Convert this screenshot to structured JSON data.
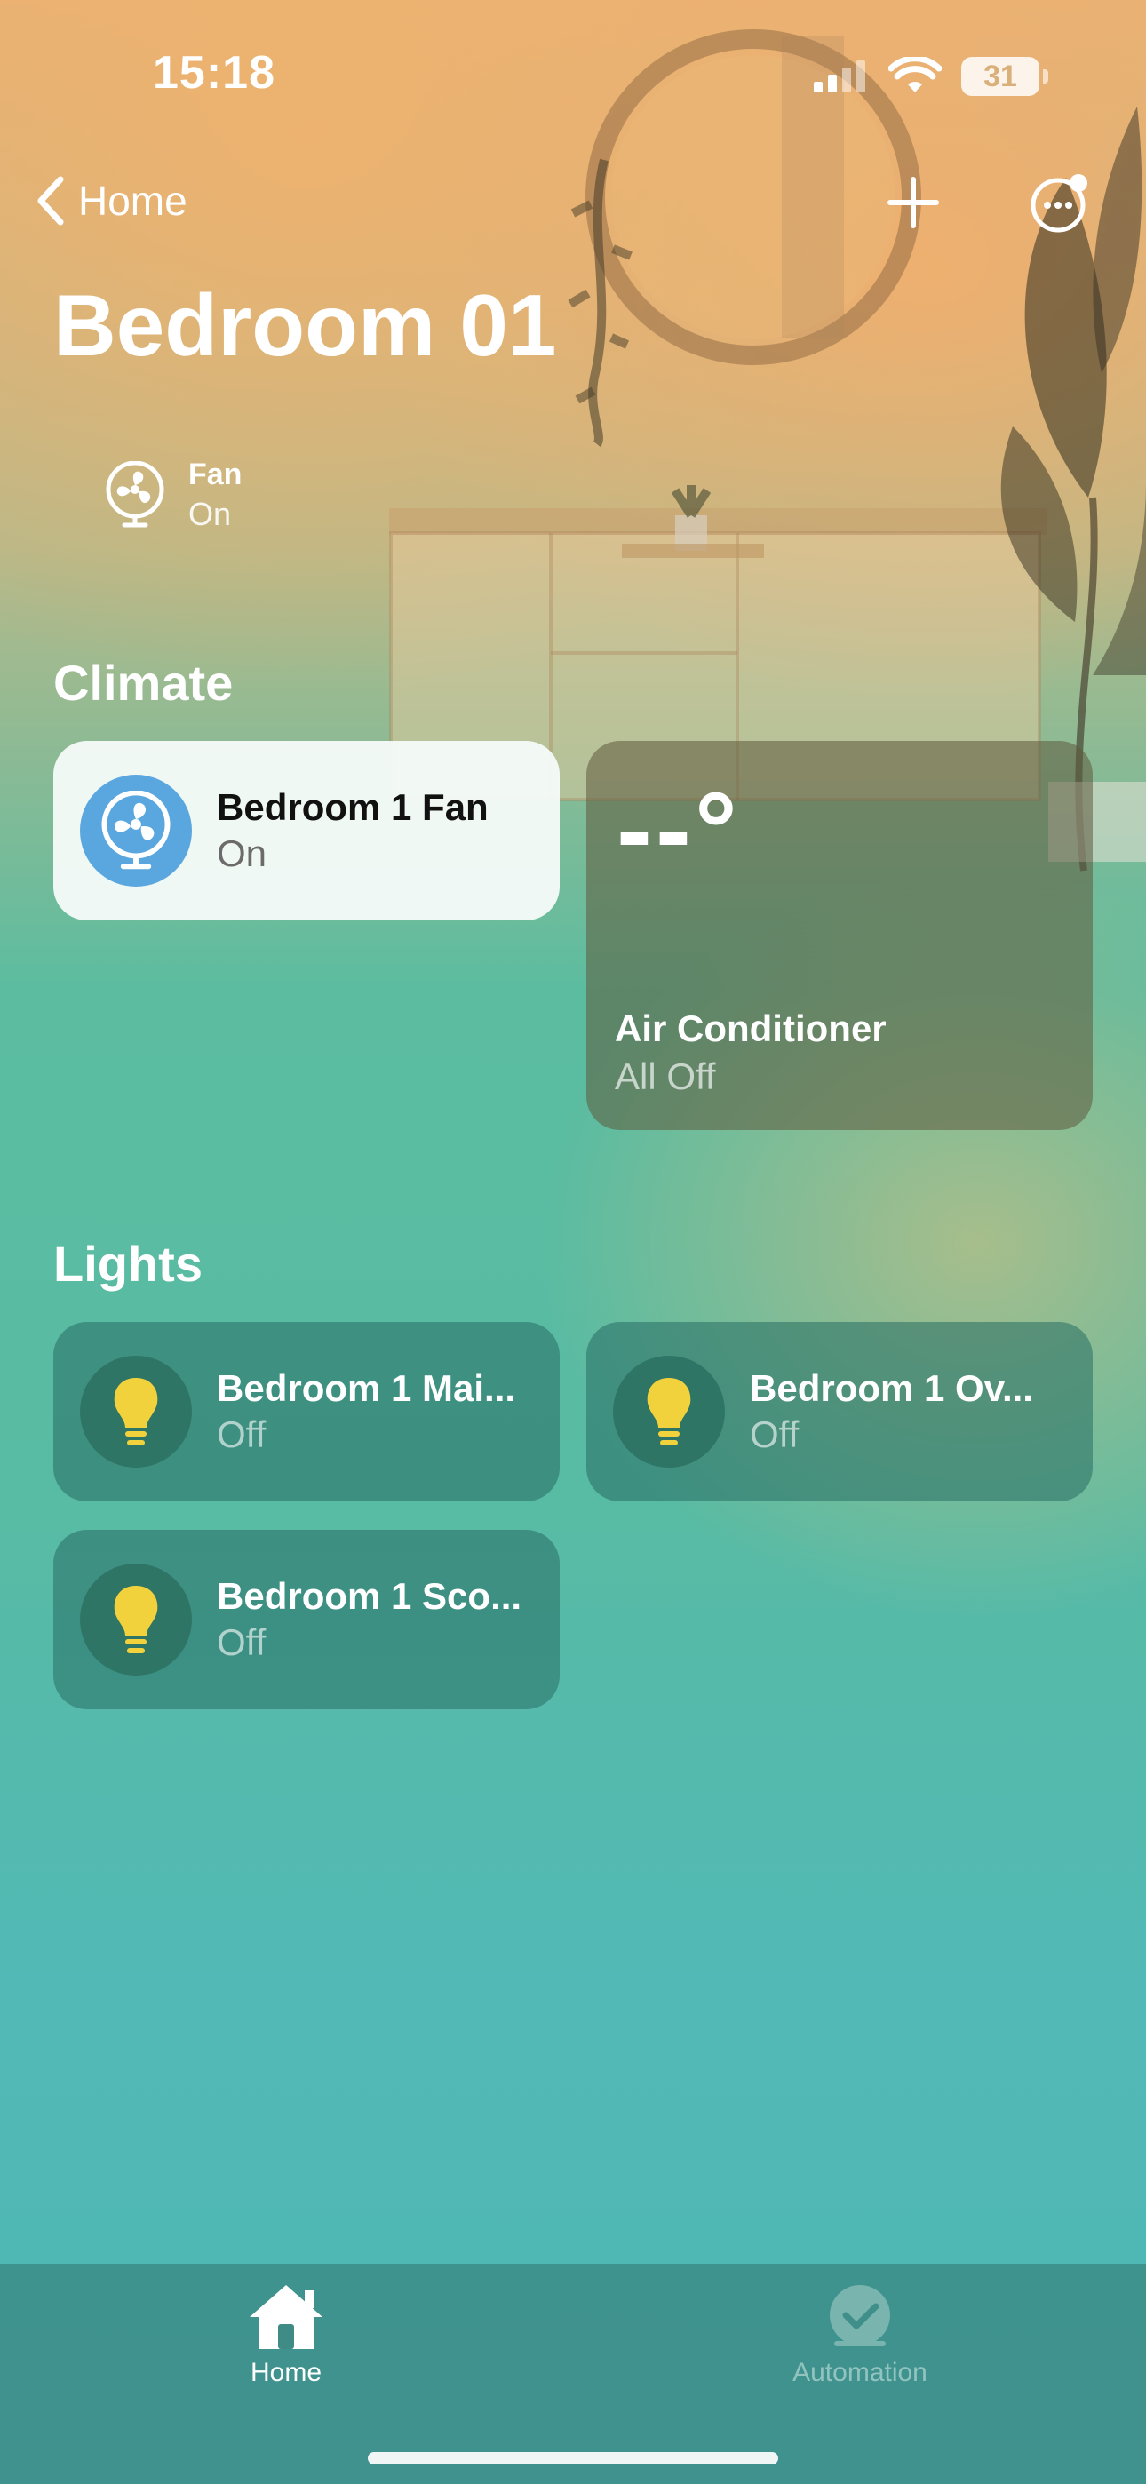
{
  "status_bar": {
    "time": "15:18",
    "battery": "31"
  },
  "nav": {
    "back_label": "Home"
  },
  "page": {
    "title": "Bedroom 01"
  },
  "status_chip": {
    "name": "Fan",
    "state": "On"
  },
  "climate": {
    "title": "Climate",
    "fan_tile": {
      "name": "Bedroom 1 Fan",
      "state": "On"
    },
    "ac_tile": {
      "temperature": "--°",
      "name": "Air Conditioner",
      "state": "All Off"
    }
  },
  "lights": {
    "title": "Lights",
    "tiles": [
      {
        "name": "Bedroom 1 Mai...",
        "state": "Off"
      },
      {
        "name": "Bedroom 1 Ov...",
        "state": "Off"
      },
      {
        "name": "Bedroom 1 Sco...",
        "state": "Off"
      }
    ]
  },
  "tabbar": {
    "home_label": "Home",
    "automation_label": "Automation"
  },
  "colors": {
    "fan_circle": "#5aa7e0",
    "light_circle": "#2f7565",
    "bulb": "#f2d23c",
    "tile_on_bg": "#f5faf8"
  }
}
